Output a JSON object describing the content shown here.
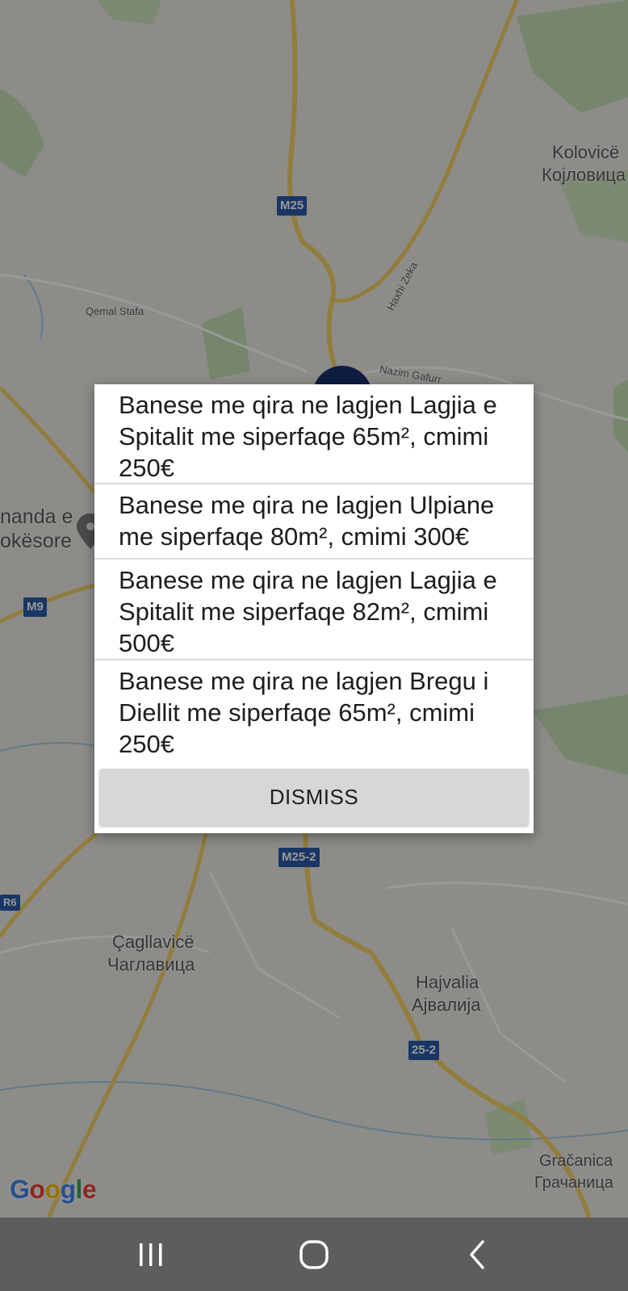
{
  "map": {
    "labels": [
      {
        "id": "kolovice",
        "text": "Kolovicë"
      },
      {
        "id": "kojlovica",
        "text": "Којловица"
      },
      {
        "id": "qemal",
        "text": "Qemal Stafa"
      },
      {
        "id": "haxhi",
        "text": "Haxhi Zeka"
      },
      {
        "id": "nazim",
        "text": "Nazim Gafurr"
      },
      {
        "id": "komanda1",
        "text": "nanda e"
      },
      {
        "id": "komanda2",
        "text": "okësore"
      },
      {
        "id": "caglavice",
        "text": "Çagllavicë"
      },
      {
        "id": "caglavica",
        "text": "Чаглавица"
      },
      {
        "id": "hajvalia",
        "text": "Hajvalia"
      },
      {
        "id": "ajvalija",
        "text": "Ајвалија"
      },
      {
        "id": "gracanica",
        "text": "Gračanica"
      },
      {
        "id": "gracanica_cyr",
        "text": "Грачаница"
      }
    ],
    "shields": {
      "m25": "M25",
      "m9": "M9",
      "m25_2": "M25-2",
      "r6": "R6",
      "r25_2": "25-2"
    },
    "logo": [
      "G",
      "o",
      "o",
      "g",
      "l",
      "e"
    ],
    "colors": {
      "scrim": "rgba(0,0,0,0.40)",
      "road_yellow": "#f2d064",
      "green": "#b9dcae",
      "shield": "#2a5aa8"
    }
  },
  "dialog": {
    "items": [
      {
        "text": "Banese me qira ne lagjen Lagjia e Spitalit me siperfaqe 65m², cmimi 250€"
      },
      {
        "text": "Banese me qira ne lagjen Ulpiane me siperfaqe 80m², cmimi 300€"
      },
      {
        "text": "Banese me qira ne lagjen Lagjia e Spitalit me siperfaqe 82m², cmimi 500€"
      },
      {
        "text": "Banese me qira ne lagjen Bregu i Diellit me siperfaqe 65m², cmimi 250€"
      }
    ],
    "dismiss_label": "DISMISS"
  },
  "navbar": {
    "icons": [
      "recent-apps-icon",
      "home-icon",
      "back-icon"
    ]
  }
}
